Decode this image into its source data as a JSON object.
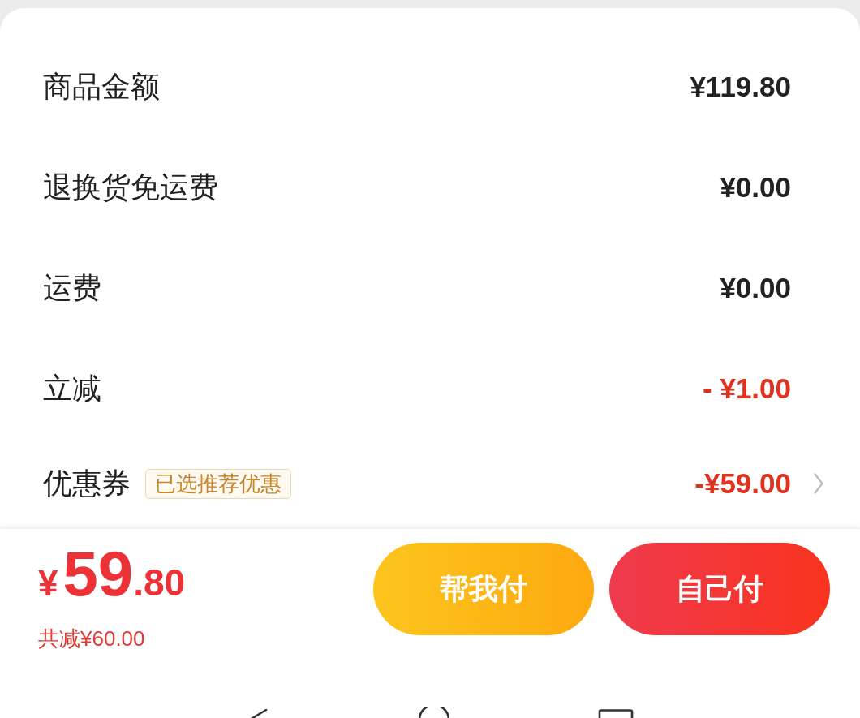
{
  "summary_rows": [
    {
      "kind": "amount",
      "label": "商品金额",
      "value": "¥119.80"
    },
    {
      "kind": "amount",
      "label": "退换货免运费",
      "value": "¥0.00"
    },
    {
      "kind": "amount",
      "label": "运费",
      "value": "¥0.00"
    },
    {
      "kind": "deduction",
      "label": "立减",
      "value": "- ¥1.00"
    },
    {
      "kind": "coupon",
      "label": "优惠券",
      "badge": "已选推荐优惠",
      "value": "-¥59.00"
    }
  ],
  "footer": {
    "total": {
      "currency": "¥",
      "integer": "59",
      "decimal": ".80"
    },
    "saving": "共减¥60.00",
    "buttons": [
      {
        "kind": "help",
        "label": "帮我付"
      },
      {
        "kind": "self",
        "label": "自己付"
      }
    ]
  }
}
